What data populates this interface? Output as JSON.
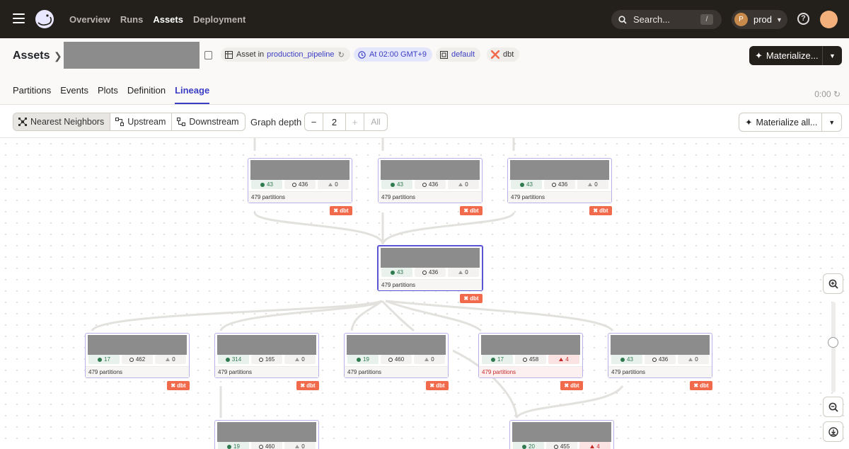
{
  "nav": {
    "links": [
      "Overview",
      "Runs",
      "Assets",
      "Deployment"
    ],
    "active": "Assets",
    "search_placeholder": "Search...",
    "search_shortcut": "/",
    "deployment_initial": "P",
    "deployment_name": "prod"
  },
  "header": {
    "breadcrumb_root": "Assets",
    "code_location_prefix": "Asset in",
    "code_location": "production_pipeline",
    "schedule": "At 02:00 GMT+9",
    "group": "default",
    "kind": "dbt",
    "materialize_label": "Materialize...",
    "tabs": [
      "Partitions",
      "Events",
      "Plots",
      "Definition",
      "Lineage"
    ],
    "active_tab": "Lineage",
    "refresh_timer": "0:00"
  },
  "toolbar": {
    "views": [
      "Nearest Neighbors",
      "Upstream",
      "Downstream"
    ],
    "active_view": "Nearest Neighbors",
    "graph_depth_label": "Graph depth",
    "graph_depth": "2",
    "all_label": "All",
    "materialize_all_label": "Materialize all..."
  },
  "graph": {
    "badge_label": "dbt",
    "nodes": [
      {
        "id": "up1",
        "ok": "43",
        "missing": "436",
        "failed": "0",
        "partitions": "479 partitions",
        "warn": false
      },
      {
        "id": "up2",
        "ok": "43",
        "missing": "436",
        "failed": "0",
        "partitions": "479 partitions",
        "warn": false
      },
      {
        "id": "up3",
        "ok": "43",
        "missing": "436",
        "failed": "0",
        "partitions": "479 partitions",
        "warn": false
      },
      {
        "id": "center",
        "ok": "43",
        "missing": "436",
        "failed": "0",
        "partitions": "479 partitions",
        "warn": false
      },
      {
        "id": "d1",
        "ok": "17",
        "missing": "462",
        "failed": "0",
        "partitions": "479 partitions",
        "warn": false
      },
      {
        "id": "d2",
        "ok": "314",
        "missing": "165",
        "failed": "0",
        "partitions": "479 partitions",
        "warn": false
      },
      {
        "id": "d3",
        "ok": "19",
        "missing": "460",
        "failed": "0",
        "partitions": "479 partitions",
        "warn": false
      },
      {
        "id": "d4",
        "ok": "17",
        "missing": "458",
        "failed": "4",
        "partitions": "479 partitions",
        "warn": true
      },
      {
        "id": "d5",
        "ok": "43",
        "missing": "436",
        "failed": "0",
        "partitions": "479 partitions",
        "warn": false
      },
      {
        "id": "dd1",
        "ok": "19",
        "missing": "460",
        "failed": "0",
        "partitions": "",
        "warn": false
      },
      {
        "id": "dd2",
        "ok": "20",
        "missing": "455",
        "failed": "4",
        "partitions": "",
        "warn": true
      }
    ]
  }
}
